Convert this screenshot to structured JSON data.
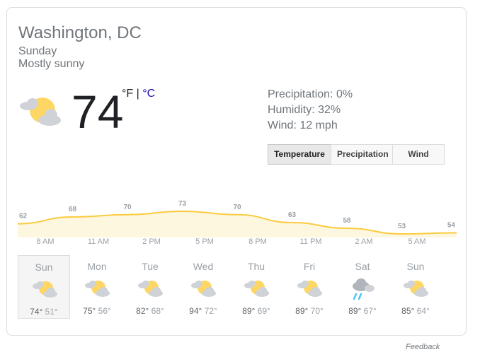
{
  "header": {
    "location": "Washington, DC",
    "day": "Sunday",
    "condition": "Mostly sunny"
  },
  "current": {
    "temperature": "74",
    "unit_f": "°F",
    "unit_sep": " | ",
    "unit_c": "°C",
    "icon": "partly-cloudy-icon"
  },
  "details": {
    "precipitation": "Precipitation: 0%",
    "humidity": "Humidity: 32%",
    "wind": "Wind: 12 mph"
  },
  "tabs": [
    {
      "label": "Temperature",
      "active": true
    },
    {
      "label": "Precipitation",
      "active": false
    },
    {
      "label": "Wind",
      "active": false
    }
  ],
  "colors": {
    "sun": "#fdd663",
    "cloud": "#cfd2d6",
    "chart_fill": "#fef7e0",
    "chart_line": "#fbcb3e",
    "rain": "#4fc3f7"
  },
  "chart_data": {
    "type": "area",
    "x": [
      "8 AM",
      "11 AM",
      "2 PM",
      "5 PM",
      "8 PM",
      "11 PM",
      "2 AM",
      "5 AM"
    ],
    "values": [
      62,
      68,
      70,
      73,
      70,
      63,
      58,
      53,
      54
    ],
    "point_labels": [
      "62",
      "68",
      "70",
      "73",
      "70",
      "63",
      "58",
      "53",
      "54"
    ],
    "unit": "°F"
  },
  "forecast": [
    {
      "day": "Sun",
      "high": "74°",
      "low": "51°",
      "icon": "partly-cloudy-icon",
      "selected": true
    },
    {
      "day": "Mon",
      "high": "75°",
      "low": "56°",
      "icon": "partly-cloudy-icon",
      "selected": false
    },
    {
      "day": "Tue",
      "high": "82°",
      "low": "68°",
      "icon": "partly-cloudy-icon",
      "selected": false
    },
    {
      "day": "Wed",
      "high": "94°",
      "low": "72°",
      "icon": "partly-cloudy-icon",
      "selected": false
    },
    {
      "day": "Thu",
      "high": "89°",
      "low": "69°",
      "icon": "partly-cloudy-icon",
      "selected": false
    },
    {
      "day": "Fri",
      "high": "89°",
      "low": "70°",
      "icon": "partly-cloudy-icon",
      "selected": false
    },
    {
      "day": "Sat",
      "high": "89°",
      "low": "67°",
      "icon": "rain-showers-icon",
      "selected": false
    },
    {
      "day": "Sun",
      "high": "85°",
      "low": "64°",
      "icon": "partly-cloudy-icon",
      "selected": false
    }
  ],
  "feedback": "Feedback"
}
